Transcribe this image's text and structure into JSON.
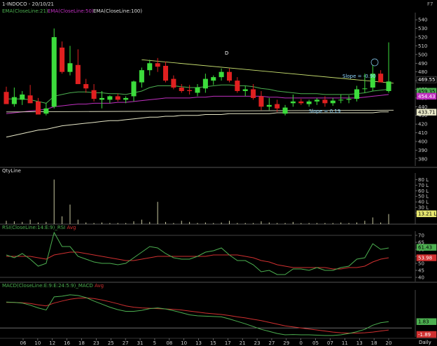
{
  "header": {
    "title": "1-INDOCO - 20/10/21",
    "f_key": "F7",
    "ema21": "EMA(CloseLine:21)",
    "ema50": "EMA(CloseLine:50)",
    "ema100": "EMA(CloseLine:100)"
  },
  "colors": {
    "bg": "#000000",
    "up": "#3cdc3c",
    "down": "#e02020",
    "ema21": "#4caf50",
    "ema50": "#c030c0",
    "ema100": "#e8e8c8",
    "trend": "#c8e070",
    "rsi": "#4caf50",
    "rsi_avg": "#d03030",
    "macd": "#4caf50",
    "macd_avg": "#d03030",
    "vol": "#c8c8a0"
  },
  "chart_data": [
    {
      "type": "candlestick",
      "name": "price",
      "ylim": [
        375,
        545
      ],
      "yticks": [
        380,
        390,
        400,
        410,
        420,
        430,
        440,
        450,
        460,
        470,
        480,
        490,
        500,
        510,
        520,
        530,
        540
      ],
      "x_labels": [
        "06",
        "10",
        "12",
        "16",
        "18",
        "23",
        "25",
        "27",
        "31",
        "5",
        "08",
        "10",
        "13",
        "15",
        "17",
        "21",
        "23",
        "27",
        "29",
        "0",
        "05",
        "07",
        "11",
        "13",
        "18",
        "20"
      ],
      "candles": [
        {
          "o": 457,
          "h": 463,
          "l": 444,
          "c": 443
        },
        {
          "o": 443,
          "h": 462,
          "l": 440,
          "c": 451
        },
        {
          "o": 448,
          "h": 458,
          "l": 442,
          "c": 454
        },
        {
          "o": 453,
          "h": 465,
          "l": 444,
          "c": 444
        },
        {
          "o": 446,
          "h": 450,
          "l": 431,
          "c": 431
        },
        {
          "o": 432,
          "h": 444,
          "l": 430,
          "c": 438
        },
        {
          "o": 440,
          "h": 530,
          "l": 438,
          "c": 520
        },
        {
          "o": 508,
          "h": 515,
          "l": 478,
          "c": 480
        },
        {
          "o": 480,
          "h": 510,
          "l": 476,
          "c": 490
        },
        {
          "o": 488,
          "h": 506,
          "l": 466,
          "c": 466
        },
        {
          "o": 466,
          "h": 472,
          "l": 456,
          "c": 461
        },
        {
          "o": 459,
          "h": 466,
          "l": 446,
          "c": 449
        },
        {
          "o": 448,
          "h": 458,
          "l": 438,
          "c": 450
        },
        {
          "o": 448,
          "h": 453,
          "l": 444,
          "c": 452
        },
        {
          "o": 452,
          "h": 455,
          "l": 446,
          "c": 448
        },
        {
          "o": 448,
          "h": 452,
          "l": 444,
          "c": 450
        },
        {
          "o": 452,
          "h": 470,
          "l": 446,
          "c": 469
        },
        {
          "o": 468,
          "h": 485,
          "l": 462,
          "c": 482
        },
        {
          "o": 482,
          "h": 494,
          "l": 476,
          "c": 490
        },
        {
          "o": 490,
          "h": 496,
          "l": 480,
          "c": 486
        },
        {
          "o": 487,
          "h": 492,
          "l": 468,
          "c": 470
        },
        {
          "o": 472,
          "h": 476,
          "l": 460,
          "c": 462
        },
        {
          "o": 462,
          "h": 466,
          "l": 456,
          "c": 458
        },
        {
          "o": 459,
          "h": 465,
          "l": 454,
          "c": 458
        },
        {
          "o": 456,
          "h": 466,
          "l": 452,
          "c": 462
        },
        {
          "o": 461,
          "h": 478,
          "l": 456,
          "c": 472
        },
        {
          "o": 470,
          "h": 476,
          "l": 465,
          "c": 474
        },
        {
          "o": 474,
          "h": 484,
          "l": 470,
          "c": 480
        },
        {
          "o": 480,
          "h": 484,
          "l": 468,
          "c": 470
        },
        {
          "o": 470,
          "h": 474,
          "l": 456,
          "c": 458
        },
        {
          "o": 458,
          "h": 464,
          "l": 452,
          "c": 460
        },
        {
          "o": 460,
          "h": 466,
          "l": 448,
          "c": 450
        },
        {
          "o": 452,
          "h": 458,
          "l": 436,
          "c": 440
        },
        {
          "o": 440,
          "h": 450,
          "l": 436,
          "c": 442
        },
        {
          "o": 443,
          "h": 448,
          "l": 434,
          "c": 438
        },
        {
          "o": 432,
          "h": 442,
          "l": 430,
          "c": 439
        },
        {
          "o": 444,
          "h": 454,
          "l": 440,
          "c": 446
        },
        {
          "o": 446,
          "h": 449,
          "l": 442,
          "c": 444
        },
        {
          "o": 443,
          "h": 448,
          "l": 440,
          "c": 446
        },
        {
          "o": 446,
          "h": 450,
          "l": 442,
          "c": 448
        },
        {
          "o": 448,
          "h": 452,
          "l": 440,
          "c": 444
        },
        {
          "o": 444,
          "h": 450,
          "l": 441,
          "c": 447
        },
        {
          "o": 448,
          "h": 454,
          "l": 444,
          "c": 448
        },
        {
          "o": 448,
          "h": 453,
          "l": 444,
          "c": 449
        },
        {
          "o": 449,
          "h": 464,
          "l": 446,
          "c": 460
        },
        {
          "o": 461,
          "h": 478,
          "l": 456,
          "c": 461
        },
        {
          "o": 462,
          "h": 488,
          "l": 458,
          "c": 478
        },
        {
          "o": 478,
          "h": 482,
          "l": 468,
          "c": 468
        },
        {
          "o": 458,
          "h": 514,
          "l": 456,
          "c": 469
        }
      ],
      "ema21": [
        449,
        449,
        449,
        448,
        446,
        444,
        452,
        454,
        456,
        457,
        457,
        456,
        456,
        455,
        455,
        454,
        456,
        458,
        462,
        464,
        464,
        464,
        463,
        462,
        462,
        463,
        464,
        465,
        465,
        464,
        464,
        463,
        461,
        460,
        458,
        457,
        456,
        455,
        455,
        455,
        454,
        454,
        454,
        454,
        455,
        456,
        458,
        459,
        460
      ],
      "ema50": [
        432,
        433,
        434,
        435,
        436,
        437,
        440,
        441,
        442,
        443,
        443,
        444,
        444,
        444,
        445,
        445,
        446,
        447,
        448,
        449,
        450,
        450,
        450,
        450,
        451,
        451,
        452,
        452,
        452,
        452,
        452,
        452,
        452,
        451,
        451,
        450,
        450,
        450,
        450,
        450,
        450,
        450,
        450,
        450,
        450,
        451,
        452,
        453,
        454
      ],
      "ema100": [
        405,
        407,
        409,
        411,
        413,
        414,
        416,
        418,
        419,
        420,
        421,
        422,
        423,
        424,
        424,
        425,
        426,
        427,
        428,
        428,
        429,
        429,
        430,
        430,
        430,
        431,
        431,
        431,
        432,
        432,
        432,
        432,
        432,
        432,
        433,
        433,
        433,
        433,
        433,
        433,
        433,
        433,
        433,
        433,
        433,
        433,
        433,
        434,
        434
      ],
      "trend_lines": [
        {
          "from": [
            17,
            494
          ],
          "to": [
            48,
            469
          ]
        },
        {
          "from": [
            0,
            434
          ],
          "to": [
            48,
            436
          ]
        }
      ],
      "annotations": {
        "slope1": "Slope = -0.90",
        "slope2": "Slope = 0.19",
        "marker": "D"
      },
      "price_labels": [
        {
          "value": 469.55,
          "text": "469.55",
          "color": "#ffffff",
          "bg": "#000000"
        },
        {
          "value": 459.35,
          "text": "459.35",
          "color": "#000000",
          "bg": "#4caf50"
        },
        {
          "value": 454.43,
          "text": "454.43",
          "color": "#ffffff",
          "bg": "#c030c0"
        },
        {
          "value": 433.71,
          "text": "433.71",
          "color": "#000000",
          "bg": "#e8e8c8"
        }
      ]
    },
    {
      "type": "bar",
      "name": "volume",
      "title": "QtyLine",
      "ylim": [
        0,
        88
      ],
      "yticks_labels": [
        "80 L",
        "70 L",
        "60 L",
        "50 L",
        "40 L",
        "30 L",
        "20 L"
      ],
      "yticks": [
        80,
        70,
        60,
        50,
        40,
        30,
        20
      ],
      "values": [
        6,
        5,
        4,
        8,
        3,
        4,
        80,
        14,
        35,
        8,
        3,
        2,
        3,
        2,
        2,
        2,
        5,
        8,
        4,
        40,
        4,
        2,
        6,
        4,
        2,
        3,
        2,
        3,
        6,
        2,
        2,
        2,
        5,
        3,
        2,
        2,
        4,
        2,
        2,
        2,
        2,
        2,
        3,
        2,
        3,
        6,
        12,
        3,
        18
      ],
      "last_label": "13.21 L"
    },
    {
      "type": "line",
      "name": "rsi",
      "title": "RSI(CloseLine:14:E:9)_RSI",
      "title_avg": "Avg",
      "ylim": [
        37,
        73
      ],
      "yticks": [
        70,
        65,
        60,
        55,
        50,
        45,
        40
      ],
      "rsi": [
        56,
        54,
        57,
        53,
        48,
        50,
        72,
        62,
        62,
        55,
        53,
        51,
        50,
        50,
        49,
        50,
        54,
        58,
        62,
        61,
        57,
        54,
        53,
        53,
        55,
        58,
        59,
        61,
        56,
        52,
        52,
        49,
        44,
        45,
        42,
        42,
        46,
        46,
        45,
        47,
        45,
        45,
        47,
        48,
        53,
        54,
        64,
        60,
        61
      ],
      "avg": [
        55,
        55,
        55,
        55,
        54,
        53,
        56,
        57,
        58,
        58,
        57,
        56,
        55,
        54,
        53,
        52,
        52,
        53,
        54,
        55,
        55,
        55,
        55,
        55,
        55,
        55,
        56,
        56,
        56,
        56,
        55,
        54,
        52,
        51,
        49,
        48,
        47,
        47,
        47,
        47,
        47,
        46,
        46,
        47,
        47,
        48,
        51,
        53,
        54
      ],
      "labels": [
        {
          "value": 61.43,
          "text": "61.43",
          "color": "#000000",
          "bg": "#4caf50"
        },
        {
          "value": 53.98,
          "text": "53.98",
          "color": "#ffffff",
          "bg": "#d03030"
        }
      ]
    },
    {
      "type": "line",
      "name": "macd",
      "title": "MACD(CloseLine:E:9:E:24:5:9)_MACD",
      "title_avg": "Avg",
      "ylim": [
        -2.6,
        11
      ],
      "zero": 0,
      "macd": [
        7.5,
        7.4,
        7.2,
        6.6,
        5.8,
        5.2,
        9,
        9.2,
        9.6,
        9.4,
        8.8,
        7.8,
        6.9,
        6,
        5.3,
        4.8,
        4.8,
        5.1,
        5.6,
        5.8,
        5.5,
        5,
        4.4,
        3.8,
        3.5,
        3.4,
        3.3,
        3.2,
        2.6,
        1.9,
        1.2,
        0.4,
        -0.4,
        -1,
        -1.6,
        -2,
        -1.9,
        -2,
        -2,
        -2.1,
        -2.2,
        -2.2,
        -2,
        -1.6,
        -1.1,
        -0.4,
        0.8,
        1.5,
        1.8
      ],
      "avg": [
        7.4,
        7.4,
        7.3,
        7.1,
        6.7,
        6.4,
        7.2,
        7.8,
        8.3,
        8.6,
        8.7,
        8.5,
        8.1,
        7.6,
        7,
        6.4,
        6,
        5.8,
        5.7,
        5.6,
        5.5,
        5.4,
        5.2,
        4.9,
        4.6,
        4.3,
        4.1,
        3.9,
        3.6,
        3.2,
        2.9,
        2.5,
        2.1,
        1.6,
        1.1,
        0.6,
        0.3,
        0,
        -0.3,
        -0.6,
        -0.9,
        -1.2,
        -1.4,
        -1.5,
        -1.5,
        -1.4,
        -1.2,
        -0.9,
        -0.6
      ],
      "labels": [
        {
          "value": 1.83,
          "text": "1.83",
          "color": "#000000",
          "bg": "#4caf50"
        },
        {
          "value": -1.89,
          "text": "-1.89",
          "color": "#ffffff",
          "bg": "#d03030"
        }
      ]
    }
  ],
  "footer": {
    "period": "Daily"
  }
}
